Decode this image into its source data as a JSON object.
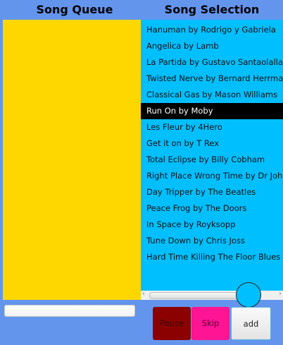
{
  "queue": {
    "title": "Song Queue",
    "items": []
  },
  "selection": {
    "title": "Song Selection",
    "selected_index": 5,
    "items": [
      "Hanuman by Rodrigo y Gabriela",
      "Angelica by Lamb",
      "La Partida by Gustavo Santaolalla",
      "Twisted Nerve by Bernard Herrmann",
      "Classical Gas by Mason Williams",
      "Run On by Moby",
      "Les Fleur by 4Hero",
      "Get it on by T Rex",
      "Total Eclipse by Billy Cobham",
      "Right Place Wrong Time by Dr John",
      "Day Tripper by The Beatles",
      "Peace Frog by The Doors",
      "In Space by Royksopp",
      "Tune Down by Chris Joss",
      "Hard Time Killing The Floor Blues by"
    ]
  },
  "input": {
    "value": ""
  },
  "buttons": {
    "pause": "Pause",
    "skip": "Skip",
    "add": "add"
  },
  "colors": {
    "background": "#6495ED",
    "queue": "#FFD700",
    "list": "#00BFFF",
    "pause": "#8B0000",
    "skip": "#FF1493"
  }
}
